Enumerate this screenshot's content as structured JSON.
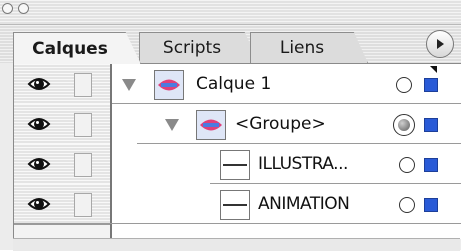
{
  "tabs": [
    {
      "label": "Calques",
      "active": true
    },
    {
      "label": "Scripts",
      "active": false
    },
    {
      "label": "Liens",
      "active": false
    }
  ],
  "layers": [
    {
      "name": "Calque 1",
      "type": "layer",
      "expanded": true,
      "visible": true,
      "target": "circle",
      "color": "#2a5bd7"
    },
    {
      "name": "<Groupe>",
      "type": "group",
      "expanded": true,
      "visible": true,
      "target": "filled",
      "color": "#2a5bd7"
    },
    {
      "name": "ILLUSTRA...",
      "type": "object",
      "visible": true,
      "target": "circle",
      "color": "#2a5bd7"
    },
    {
      "name": "ANIMATION",
      "type": "object",
      "visible": true,
      "target": "circle",
      "color": "#2a5bd7"
    }
  ],
  "icons": {
    "visibility": "eye-icon",
    "lock": "lock-toggle",
    "panel_menu": "panel-menu-icon"
  }
}
